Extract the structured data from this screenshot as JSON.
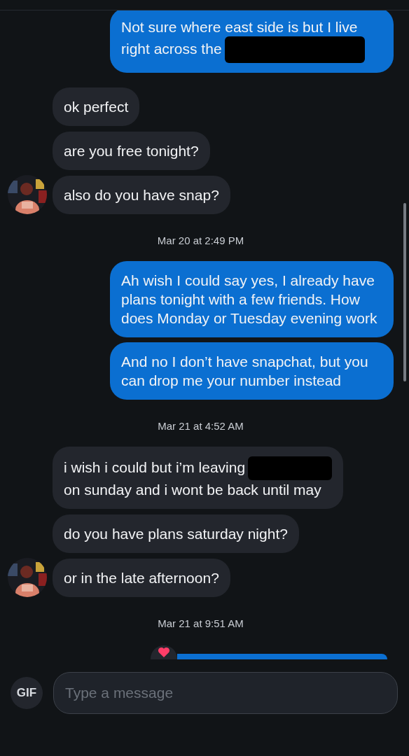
{
  "messages": [
    {
      "kind": "sent",
      "text": "Not sure where east side is but I live right across the",
      "redacted": true
    },
    {
      "kind": "received",
      "text": "ok perfect",
      "avatar": false
    },
    {
      "kind": "received",
      "text": "are you free tonight?",
      "avatar": false
    },
    {
      "kind": "received",
      "text": "also do you have snap?",
      "avatar": true
    },
    {
      "kind": "date",
      "text": "Mar 20 at 2:49 PM"
    },
    {
      "kind": "sent",
      "text": "Ah wish I could say yes, I already have plans tonight with a few friends. How does Monday or Tuesday evening work"
    },
    {
      "kind": "sent",
      "text": "And no I don’t have snapchat, but you can drop me your number instead"
    },
    {
      "kind": "date",
      "text": "Mar 21 at 4:52 AM"
    },
    {
      "kind": "received",
      "text": "i wish i could but i’m leaving",
      "redacted": true,
      "text_after": "on sunday and i wont be back until may",
      "avatar": false
    },
    {
      "kind": "received",
      "text": "do you have plans saturday night?",
      "avatar": false
    },
    {
      "kind": "received",
      "text": "or in the late afternoon?",
      "avatar": true
    },
    {
      "kind": "date",
      "text": "Mar 21 at 9:51 AM"
    },
    {
      "kind": "partial_sent",
      "reacted": true
    }
  ],
  "composer": {
    "gif_label": "GIF",
    "placeholder": "Type a message"
  }
}
